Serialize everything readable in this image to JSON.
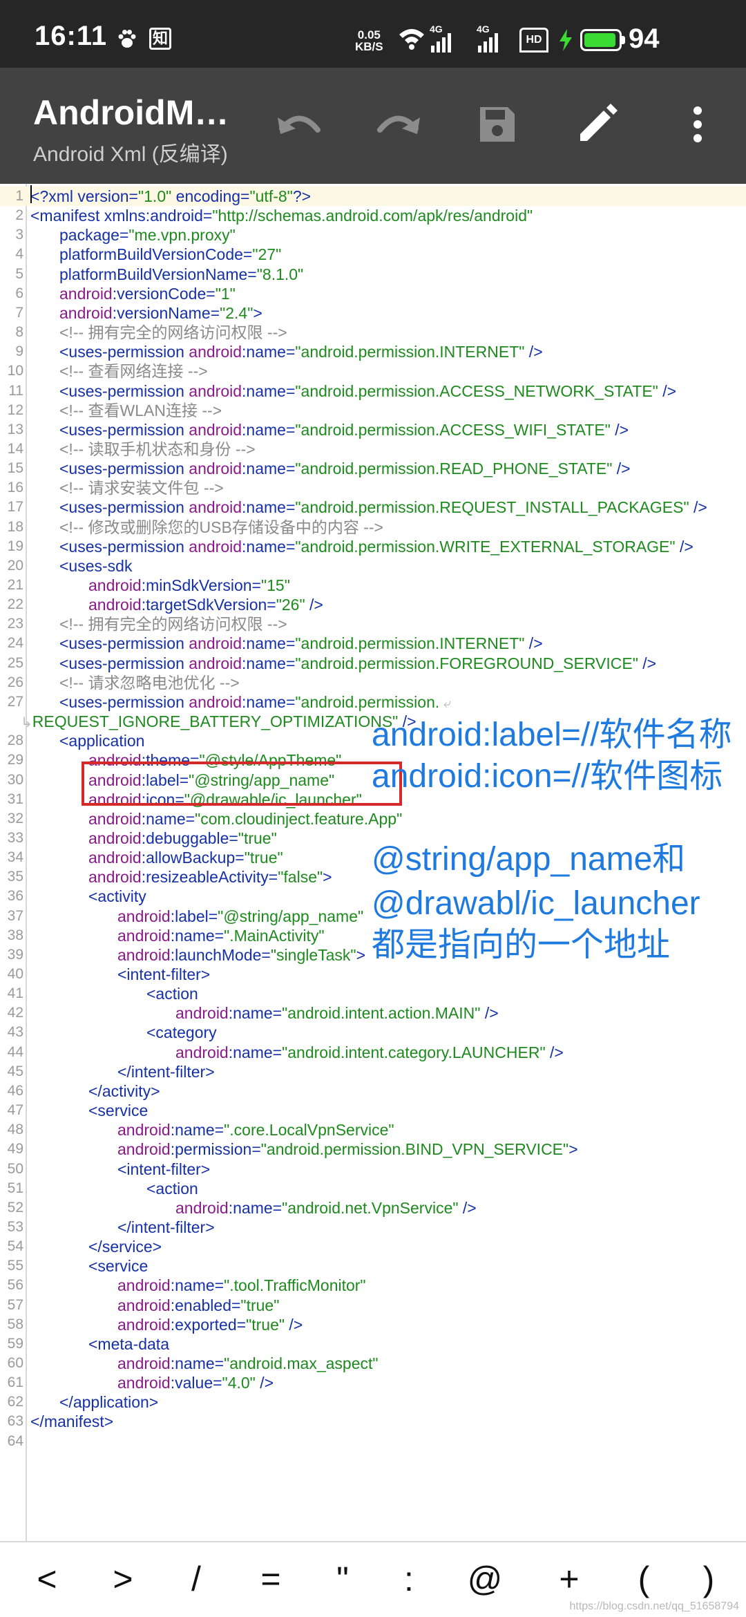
{
  "status_bar": {
    "time": "16:11",
    "net_speed_value": "0.05",
    "net_speed_unit": "KB/S",
    "signal1_label": "4G",
    "signal2_label": "4G",
    "hd_label": "HD",
    "battery_level": "94",
    "battery_fraction": 0.94,
    "zhihu_label": "知",
    "colors": {
      "background": "#262626",
      "battery": "#3adc34"
    }
  },
  "toolbar": {
    "title": "AndroidManifest.xml",
    "subtitle": "Android Xml (反编译)",
    "icons": [
      "undo-icon",
      "redo-icon",
      "save-icon",
      "edit-icon",
      "more-vert-icon"
    ],
    "background": "#424242"
  },
  "editor": {
    "lines": [
      {
        "n": "1",
        "indent": 0,
        "t": [
          [
            "pi",
            "<?xml "
          ],
          [
            "attr",
            "version="
          ],
          [
            "val",
            "\"1.0\""
          ],
          [
            "pi",
            " "
          ],
          [
            "attr",
            "encoding="
          ],
          [
            "val",
            "\"utf-8\""
          ],
          [
            "pi",
            "?>"
          ]
        ]
      },
      {
        "n": "2",
        "indent": 0,
        "t": [
          [
            "tag",
            "<manifest "
          ],
          [
            "attr",
            "xmlns:android="
          ],
          [
            "val",
            "\"http://schemas.android.com/apk/res/android\""
          ]
        ]
      },
      {
        "n": "3",
        "indent": 1,
        "t": [
          [
            "attr",
            "package="
          ],
          [
            "val",
            "\"me.vpn.proxy\""
          ]
        ]
      },
      {
        "n": "4",
        "indent": 1,
        "t": [
          [
            "attr",
            "platformBuildVersionCode="
          ],
          [
            "val",
            "\"27\""
          ]
        ]
      },
      {
        "n": "5",
        "indent": 1,
        "t": [
          [
            "attr",
            "platformBuildVersionName="
          ],
          [
            "val",
            "\"8.1.0\""
          ]
        ]
      },
      {
        "n": "6",
        "indent": 1,
        "t": [
          [
            "ns",
            "android"
          ],
          [
            "attr",
            ":versionCode="
          ],
          [
            "val",
            "\"1\""
          ]
        ]
      },
      {
        "n": "7",
        "indent": 1,
        "t": [
          [
            "ns",
            "android"
          ],
          [
            "attr",
            ":versionName="
          ],
          [
            "val",
            "\"2.4\""
          ],
          [
            "tag",
            ">"
          ]
        ]
      },
      {
        "n": "8",
        "indent": 1,
        "t": [
          [
            "cm",
            "<!-- 拥有完全的网络访问权限 -->"
          ]
        ]
      },
      {
        "n": "9",
        "indent": 1,
        "t": [
          [
            "tag",
            "<uses-permission "
          ],
          [
            "ns",
            "android"
          ],
          [
            "attr",
            ":name="
          ],
          [
            "val",
            "\"android.permission.INTERNET\""
          ],
          [
            "tag",
            " />"
          ]
        ]
      },
      {
        "n": "10",
        "indent": 1,
        "t": [
          [
            "cm",
            "<!-- 查看网络连接 -->"
          ]
        ]
      },
      {
        "n": "11",
        "indent": 1,
        "t": [
          [
            "tag",
            "<uses-permission "
          ],
          [
            "ns",
            "android"
          ],
          [
            "attr",
            ":name="
          ],
          [
            "val",
            "\"android.permission.ACCESS_NETWORK_STATE\""
          ],
          [
            "tag",
            " />"
          ]
        ]
      },
      {
        "n": "12",
        "indent": 1,
        "t": [
          [
            "cm",
            "<!-- 查看WLAN连接 -->"
          ]
        ]
      },
      {
        "n": "13",
        "indent": 1,
        "t": [
          [
            "tag",
            "<uses-permission "
          ],
          [
            "ns",
            "android"
          ],
          [
            "attr",
            ":name="
          ],
          [
            "val",
            "\"android.permission.ACCESS_WIFI_STATE\""
          ],
          [
            "tag",
            " />"
          ]
        ]
      },
      {
        "n": "14",
        "indent": 1,
        "t": [
          [
            "cm",
            "<!-- 读取手机状态和身份 -->"
          ]
        ]
      },
      {
        "n": "15",
        "indent": 1,
        "t": [
          [
            "tag",
            "<uses-permission "
          ],
          [
            "ns",
            "android"
          ],
          [
            "attr",
            ":name="
          ],
          [
            "val",
            "\"android.permission.READ_PHONE_STATE\""
          ],
          [
            "tag",
            " />"
          ]
        ]
      },
      {
        "n": "16",
        "indent": 1,
        "t": [
          [
            "cm",
            "<!-- 请求安装文件包 -->"
          ]
        ]
      },
      {
        "n": "17",
        "indent": 1,
        "t": [
          [
            "tag",
            "<uses-permission "
          ],
          [
            "ns",
            "android"
          ],
          [
            "attr",
            ":name="
          ],
          [
            "val",
            "\"android.permission.REQUEST_INSTALL_PACKAGES\""
          ],
          [
            "tag",
            " />"
          ]
        ]
      },
      {
        "n": "18",
        "indent": 1,
        "t": [
          [
            "cm",
            "<!-- 修改或删除您的USB存储设备中的内容 -->"
          ]
        ]
      },
      {
        "n": "19",
        "indent": 1,
        "t": [
          [
            "tag",
            "<uses-permission "
          ],
          [
            "ns",
            "android"
          ],
          [
            "attr",
            ":name="
          ],
          [
            "val",
            "\"android.permission.WRITE_EXTERNAL_STORAGE\""
          ],
          [
            "tag",
            " />"
          ]
        ]
      },
      {
        "n": "20",
        "indent": 1,
        "t": [
          [
            "tag",
            "<uses-sdk"
          ]
        ]
      },
      {
        "n": "21",
        "indent": 2,
        "t": [
          [
            "ns",
            "android"
          ],
          [
            "attr",
            ":minSdkVersion="
          ],
          [
            "val",
            "\"15\""
          ]
        ]
      },
      {
        "n": "22",
        "indent": 2,
        "t": [
          [
            "ns",
            "android"
          ],
          [
            "attr",
            ":targetSdkVersion="
          ],
          [
            "val",
            "\"26\""
          ],
          [
            "tag",
            " />"
          ]
        ]
      },
      {
        "n": "23",
        "indent": 1,
        "t": [
          [
            "cm",
            "<!-- 拥有完全的网络访问权限 -->"
          ]
        ]
      },
      {
        "n": "24",
        "indent": 1,
        "t": [
          [
            "tag",
            "<uses-permission "
          ],
          [
            "ns",
            "android"
          ],
          [
            "attr",
            ":name="
          ],
          [
            "val",
            "\"android.permission.INTERNET\""
          ],
          [
            "tag",
            " />"
          ]
        ]
      },
      {
        "n": "25",
        "indent": 1,
        "t": [
          [
            "tag",
            "<uses-permission "
          ],
          [
            "ns",
            "android"
          ],
          [
            "attr",
            ":name="
          ],
          [
            "val",
            "\"android.permission.FOREGROUND_SERVICE\""
          ],
          [
            "tag",
            " />"
          ]
        ]
      },
      {
        "n": "26",
        "indent": 1,
        "t": [
          [
            "cm",
            "<!-- 请求忽略电池优化 -->"
          ]
        ]
      },
      {
        "n": "27",
        "indent": 1,
        "t": [
          [
            "tag",
            "<uses-permission "
          ],
          [
            "ns",
            "android"
          ],
          [
            "attr",
            ":name="
          ],
          [
            "val",
            "\"android.permission."
          ],
          [
            "wrap",
            " ⤶"
          ]
        ]
      },
      {
        "n": "",
        "indent": 0,
        "wrapped": true,
        "t": [
          [
            "wrap",
            "↳"
          ],
          [
            "val",
            "REQUEST_IGNORE_BATTERY_OPTIMIZATIONS\""
          ],
          [
            "tag",
            " />"
          ]
        ]
      },
      {
        "n": "28",
        "indent": 1,
        "t": [
          [
            "tag",
            "<application"
          ]
        ]
      },
      {
        "n": "29",
        "indent": 2,
        "t": [
          [
            "ns",
            "android"
          ],
          [
            "attr",
            ":theme="
          ],
          [
            "val",
            "\"@style/AppTheme\""
          ]
        ]
      },
      {
        "n": "30",
        "indent": 2,
        "t": [
          [
            "ns",
            "android"
          ],
          [
            "attr",
            ":label="
          ],
          [
            "val",
            "\"@string/app_name\""
          ]
        ]
      },
      {
        "n": "31",
        "indent": 2,
        "t": [
          [
            "ns",
            "android"
          ],
          [
            "attr",
            ":icon="
          ],
          [
            "val",
            "\"@drawable/ic_launcher\""
          ]
        ]
      },
      {
        "n": "32",
        "indent": 2,
        "t": [
          [
            "ns",
            "android"
          ],
          [
            "attr",
            ":name="
          ],
          [
            "val",
            "\"com.cloudinject.feature.App\""
          ]
        ]
      },
      {
        "n": "33",
        "indent": 2,
        "t": [
          [
            "ns",
            "android"
          ],
          [
            "attr",
            ":debuggable="
          ],
          [
            "val",
            "\"true\""
          ]
        ]
      },
      {
        "n": "34",
        "indent": 2,
        "t": [
          [
            "ns",
            "android"
          ],
          [
            "attr",
            ":allowBackup="
          ],
          [
            "val",
            "\"true\""
          ]
        ]
      },
      {
        "n": "35",
        "indent": 2,
        "t": [
          [
            "ns",
            "android"
          ],
          [
            "attr",
            ":resizeableActivity="
          ],
          [
            "val",
            "\"false\""
          ],
          [
            "tag",
            ">"
          ]
        ]
      },
      {
        "n": "36",
        "indent": 2,
        "t": [
          [
            "tag",
            "<activity"
          ]
        ]
      },
      {
        "n": "37",
        "indent": 3,
        "t": [
          [
            "ns",
            "android"
          ],
          [
            "attr",
            ":label="
          ],
          [
            "val",
            "\"@string/app_name\""
          ]
        ]
      },
      {
        "n": "38",
        "indent": 3,
        "t": [
          [
            "ns",
            "android"
          ],
          [
            "attr",
            ":name="
          ],
          [
            "val",
            "\".MainActivity\""
          ]
        ]
      },
      {
        "n": "39",
        "indent": 3,
        "t": [
          [
            "ns",
            "android"
          ],
          [
            "attr",
            ":launchMode="
          ],
          [
            "val",
            "\"singleTask\""
          ],
          [
            "tag",
            ">"
          ]
        ]
      },
      {
        "n": "40",
        "indent": 3,
        "t": [
          [
            "tag",
            "<intent-filter>"
          ]
        ]
      },
      {
        "n": "41",
        "indent": 4,
        "t": [
          [
            "tag",
            "<action"
          ]
        ]
      },
      {
        "n": "42",
        "indent": 5,
        "t": [
          [
            "ns",
            "android"
          ],
          [
            "attr",
            ":name="
          ],
          [
            "val",
            "\"android.intent.action.MAIN\""
          ],
          [
            "tag",
            " />"
          ]
        ]
      },
      {
        "n": "43",
        "indent": 4,
        "t": [
          [
            "tag",
            "<category"
          ]
        ]
      },
      {
        "n": "44",
        "indent": 5,
        "t": [
          [
            "ns",
            "android"
          ],
          [
            "attr",
            ":name="
          ],
          [
            "val",
            "\"android.intent.category.LAUNCHER\""
          ],
          [
            "tag",
            " />"
          ]
        ]
      },
      {
        "n": "45",
        "indent": 3,
        "t": [
          [
            "tag",
            "</intent-filter>"
          ]
        ]
      },
      {
        "n": "46",
        "indent": 2,
        "t": [
          [
            "tag",
            "</activity>"
          ]
        ]
      },
      {
        "n": "47",
        "indent": 2,
        "t": [
          [
            "tag",
            "<service"
          ]
        ]
      },
      {
        "n": "48",
        "indent": 3,
        "t": [
          [
            "ns",
            "android"
          ],
          [
            "attr",
            ":name="
          ],
          [
            "val",
            "\".core.LocalVpnService\""
          ]
        ]
      },
      {
        "n": "49",
        "indent": 3,
        "t": [
          [
            "ns",
            "android"
          ],
          [
            "attr",
            ":permission="
          ],
          [
            "val",
            "\"android.permission.BIND_VPN_SERVICE\""
          ],
          [
            "tag",
            ">"
          ]
        ]
      },
      {
        "n": "50",
        "indent": 3,
        "t": [
          [
            "tag",
            "<intent-filter>"
          ]
        ]
      },
      {
        "n": "51",
        "indent": 4,
        "t": [
          [
            "tag",
            "<action"
          ]
        ]
      },
      {
        "n": "52",
        "indent": 5,
        "t": [
          [
            "ns",
            "android"
          ],
          [
            "attr",
            ":name="
          ],
          [
            "val",
            "\"android.net.VpnService\""
          ],
          [
            "tag",
            " />"
          ]
        ]
      },
      {
        "n": "53",
        "indent": 3,
        "t": [
          [
            "tag",
            "</intent-filter>"
          ]
        ]
      },
      {
        "n": "54",
        "indent": 2,
        "t": [
          [
            "tag",
            "</service>"
          ]
        ]
      },
      {
        "n": "55",
        "indent": 2,
        "t": [
          [
            "tag",
            "<service"
          ]
        ]
      },
      {
        "n": "56",
        "indent": 3,
        "t": [
          [
            "ns",
            "android"
          ],
          [
            "attr",
            ":name="
          ],
          [
            "val",
            "\".tool.TrafficMonitor\""
          ]
        ]
      },
      {
        "n": "57",
        "indent": 3,
        "t": [
          [
            "ns",
            "android"
          ],
          [
            "attr",
            ":enabled="
          ],
          [
            "val",
            "\"true\""
          ]
        ]
      },
      {
        "n": "58",
        "indent": 3,
        "t": [
          [
            "ns",
            "android"
          ],
          [
            "attr",
            ":exported="
          ],
          [
            "val",
            "\"true\""
          ],
          [
            "tag",
            " />"
          ]
        ]
      },
      {
        "n": "59",
        "indent": 2,
        "t": [
          [
            "tag",
            "<meta-data"
          ]
        ]
      },
      {
        "n": "60",
        "indent": 3,
        "t": [
          [
            "ns",
            "android"
          ],
          [
            "attr",
            ":name="
          ],
          [
            "val",
            "\"android.max_aspect\""
          ]
        ]
      },
      {
        "n": "61",
        "indent": 3,
        "t": [
          [
            "ns",
            "android"
          ],
          [
            "attr",
            ":value="
          ],
          [
            "val",
            "\"4.0\""
          ],
          [
            "tag",
            " />"
          ]
        ]
      },
      {
        "n": "62",
        "indent": 1,
        "t": [
          [
            "tag",
            "</application>"
          ]
        ]
      },
      {
        "n": "63",
        "indent": 0,
        "t": [
          [
            "tag",
            "</manifest>"
          ]
        ]
      },
      {
        "n": "64",
        "indent": 0,
        "t": []
      }
    ],
    "colors": {
      "tag": "#1530a8",
      "namespace": "#8a1a8a",
      "value": "#1e8a1e",
      "comment": "#8a8a8a",
      "current_line": "#fdf8e3"
    }
  },
  "annotations": {
    "note_label": "android:label=//软件名称",
    "note_icon": "android:icon=//软件图标",
    "note_res_1": "@string/app_name和",
    "note_res_2": "@drawabl/ic_launcher",
    "note_res_3": "都是指向的一个地址",
    "color": "#1f7ae0",
    "highlight_color": "#d42a2a"
  },
  "symbol_bar": {
    "keys": [
      "<",
      ">",
      "/",
      "=",
      "\"",
      ":",
      "@",
      "+",
      "(",
      ")"
    ]
  },
  "watermark": "https://blog.csdn.net/qq_51658794"
}
